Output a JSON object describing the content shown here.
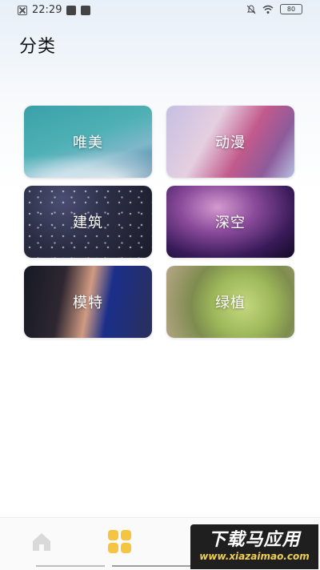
{
  "status_bar": {
    "time": "22:29",
    "battery": "80",
    "left_icons": [
      "close-icon",
      "mail-icon",
      "cast-icon"
    ],
    "right_icons": [
      "mute-icon",
      "wifi-icon",
      "battery-icon"
    ]
  },
  "header": {
    "title": "分类"
  },
  "categories": [
    {
      "label": "唯美"
    },
    {
      "label": "动漫"
    },
    {
      "label": "建筑"
    },
    {
      "label": "深空"
    },
    {
      "label": "模特"
    },
    {
      "label": "绿植"
    }
  ],
  "bottom_nav": {
    "items": [
      {
        "icon": "home-icon",
        "active": false
      },
      {
        "icon": "category-icon",
        "active": true,
        "color": "#f5c542"
      }
    ]
  },
  "watermark": {
    "title": "下载马应用",
    "url": "www.xiazaimao.com"
  },
  "colors": {
    "accent": "#f5c542",
    "title_text": "#111111"
  }
}
